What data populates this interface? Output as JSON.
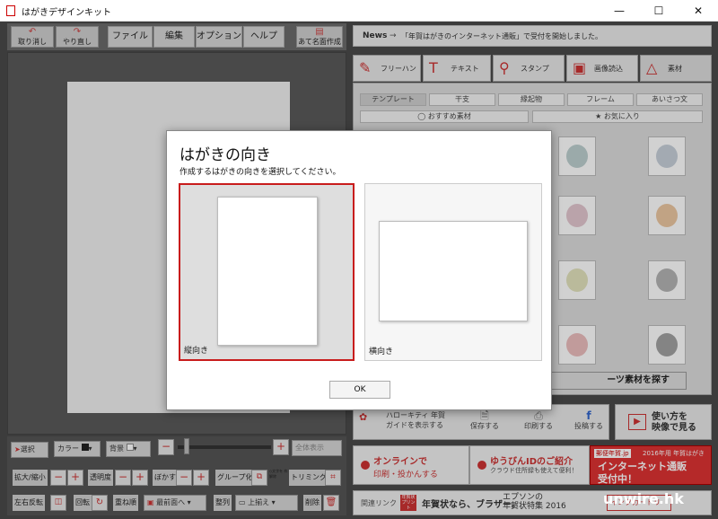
{
  "window": {
    "title": "はがきデザインキット",
    "minimize": "—",
    "maximize": "☐",
    "close": "✕"
  },
  "toolbar": {
    "undo": "取り消し",
    "redo": "やり直し",
    "menu": [
      "ファイル",
      "編集",
      "オプション",
      "ヘルプ"
    ],
    "address": "あて名面作成"
  },
  "news": {
    "label": "News",
    "arrow": "→",
    "text": "「年賀はがきのインターネット通販」で受付を開始しました。"
  },
  "right_tabs": [
    {
      "label": "フリーハンド",
      "icon": "✎"
    },
    {
      "label": "テキスト",
      "icon": "T"
    },
    {
      "label": "スタンプ",
      "icon": "⚲"
    },
    {
      "label": "画像読込",
      "icon": "▣"
    },
    {
      "label": "素材",
      "icon": "△"
    }
  ],
  "categories": [
    "テンプレート",
    "干支",
    "縁起物",
    "フレーム",
    "あいさつ文"
  ],
  "fav": {
    "recommended": "おすすめ素材",
    "favorites": "お気に入り"
  },
  "search_button": "ーツ素材を探す",
  "actions": [
    {
      "label": "ハローキティ 年賀",
      "label2": "ガイドを表示する",
      "icon": "✿"
    },
    {
      "label": "保存する",
      "icon": "🗎"
    },
    {
      "label": "印刷する",
      "icon": "⎙"
    },
    {
      "label": "投稿する",
      "icon": "f"
    }
  ],
  "video": {
    "line1": "使い方を",
    "line2": "映像で見る",
    "icon": "▶"
  },
  "promo1": {
    "line1": "オンラインで",
    "line2": "印刷・投かんする"
  },
  "promo2": {
    "line1": "ゆうびんIDのご紹介",
    "line2": "クラウド住所録も使えて便利！"
  },
  "promo3": {
    "tag": "郵便年賀.jp",
    "tag2": "2016年用 年賀はがき",
    "line1": "インターネット通販",
    "line2": "受付中！"
  },
  "links": {
    "label": "関連リンク",
    "badge": "年賀状 プリント",
    "ad1": "年賀状なら、ブラザー。",
    "ad2a": "エプソンの",
    "ad2b": "年賀状特集 2016",
    "ad3": "インクカートリ"
  },
  "bottom": {
    "select": "選択",
    "color": "カラー",
    "bg": "背景",
    "fullscreen": "全体表示",
    "scale": "拡大/縮小",
    "opacity": "透明度",
    "blur": "ぼかす",
    "gradient": "グループ化",
    "gradient_sub": "◇文字を 枠解除",
    "trim": "トリミング",
    "flip": "左右反転",
    "rotate": "回転",
    "order": "重ね順",
    "front": "最前面へ",
    "align": "整列",
    "align_sel": "上揃え",
    "delete": "削除",
    "minus": "−",
    "plus": "+"
  },
  "dialog": {
    "title": "はがきの向き",
    "subtitle": "作成するはがきの向きを選択してください。",
    "portrait": "縦向き",
    "landscape": "横向き",
    "ok": "OK"
  },
  "watermark": "unwire.hk",
  "colors": {
    "accent": "#c81c1c",
    "app_bg": "#4a4a4a"
  }
}
